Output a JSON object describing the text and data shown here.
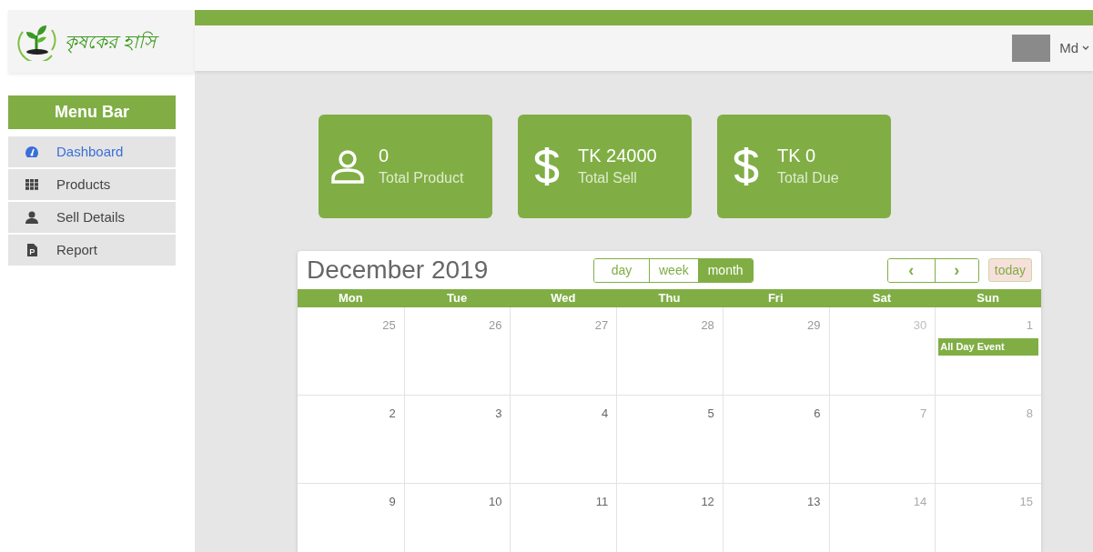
{
  "brand": {
    "name": "কৃষকের হাসি"
  },
  "user": {
    "name": "Md"
  },
  "sidebar": {
    "title": "Menu Bar",
    "items": [
      {
        "label": "Dashboard",
        "kind": "gauge",
        "selected": true
      },
      {
        "label": "Products",
        "kind": "grid",
        "selected": false
      },
      {
        "label": "Sell Details",
        "kind": "user",
        "selected": false
      },
      {
        "label": "Report",
        "kind": "file",
        "selected": false
      }
    ]
  },
  "stats": [
    {
      "value": "0",
      "label": "Total Product",
      "kind": "user"
    },
    {
      "value": "TK 24000",
      "label": "Total Sell",
      "kind": "dollar"
    },
    {
      "value": "TK 0",
      "label": "Total Due",
      "kind": "dollar"
    }
  ],
  "calendar": {
    "title": "December 2019",
    "views": [
      {
        "label": "day",
        "selected": false
      },
      {
        "label": "week",
        "selected": false
      },
      {
        "label": "month",
        "selected": true
      }
    ],
    "prev": "‹",
    "next": "›",
    "today": "today",
    "weekdays": [
      "Mon",
      "Tue",
      "Wed",
      "Thu",
      "Fri",
      "Sat",
      "Sun"
    ],
    "weeks": [
      [
        {
          "day": "25",
          "other_month": true,
          "weekend": false
        },
        {
          "day": "26",
          "other_month": true,
          "weekend": false
        },
        {
          "day": "27",
          "other_month": true,
          "weekend": false
        },
        {
          "day": "28",
          "other_month": true,
          "weekend": false
        },
        {
          "day": "29",
          "other_month": true,
          "weekend": false
        },
        {
          "day": "30",
          "other_month": true,
          "weekend": true
        },
        {
          "day": "1",
          "other_month": false,
          "weekend": true,
          "events": [
            "All Day Event"
          ]
        }
      ],
      [
        {
          "day": "2",
          "other_month": false,
          "weekend": false
        },
        {
          "day": "3",
          "other_month": false,
          "weekend": false
        },
        {
          "day": "4",
          "other_month": false,
          "weekend": false
        },
        {
          "day": "5",
          "other_month": false,
          "weekend": false
        },
        {
          "day": "6",
          "other_month": false,
          "weekend": false
        },
        {
          "day": "7",
          "other_month": false,
          "weekend": true
        },
        {
          "day": "8",
          "other_month": false,
          "weekend": true
        }
      ],
      [
        {
          "day": "9",
          "other_month": false,
          "weekend": false
        },
        {
          "day": "10",
          "other_month": false,
          "weekend": false
        },
        {
          "day": "11",
          "other_month": false,
          "weekend": false
        },
        {
          "day": "12",
          "other_month": false,
          "weekend": false
        },
        {
          "day": "13",
          "other_month": false,
          "weekend": false
        },
        {
          "day": "14",
          "other_month": false,
          "weekend": true
        },
        {
          "day": "15",
          "other_month": false,
          "weekend": true
        }
      ]
    ]
  }
}
